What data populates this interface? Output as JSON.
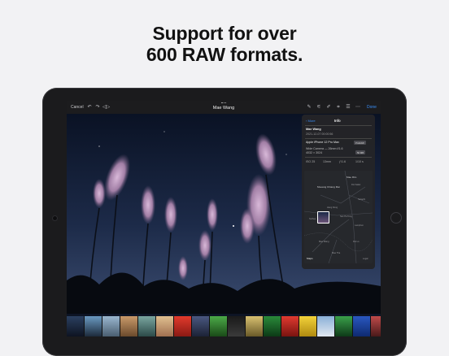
{
  "headline": {
    "line1": "Support for over",
    "line2": "600 RAW formats."
  },
  "toolbar": {
    "cancel_label": "Cancel",
    "title": "Mae Wang",
    "done_label": "Done"
  },
  "info_panel": {
    "back_label": "More",
    "title": "Info",
    "date": "2021-12-07 00:00:56",
    "device": "Apple iPhone 12 Pro Max",
    "format_badge": "ProRAW",
    "lens": "Wide Camera — 26mm f/1.6",
    "resolution": "4032 × 3024",
    "size_badge": "50 MB",
    "exif": [
      "ISO 25",
      "13mm",
      "ƒ/1.6",
      "1/10 s"
    ],
    "maps_label": "Maps",
    "legal_label": "Legal"
  },
  "map": {
    "places": [
      "Mae Rim",
      "Mueang Chiang Mai",
      "Saraphi",
      "Hang Dong",
      "San Pa Tong",
      "Doi Saket",
      "Lamphun",
      "Suthep",
      "Mae Wang",
      "Doi Lo",
      "Mae Tha"
    ]
  },
  "colors": {
    "accent": "#3a8ef6",
    "sky_top": "#0b1326",
    "sky_bottom": "#2b3a5c",
    "flower": "#c9a7c9"
  },
  "icons": [
    "grabber-icon",
    "undo-icon",
    "redo-icon",
    "compare-icon",
    "pen-icon",
    "adjust-icon",
    "brush-icon",
    "crop-icon",
    "list-icon",
    "more-icon",
    "back-chevron-icon",
    "pin-icon"
  ]
}
